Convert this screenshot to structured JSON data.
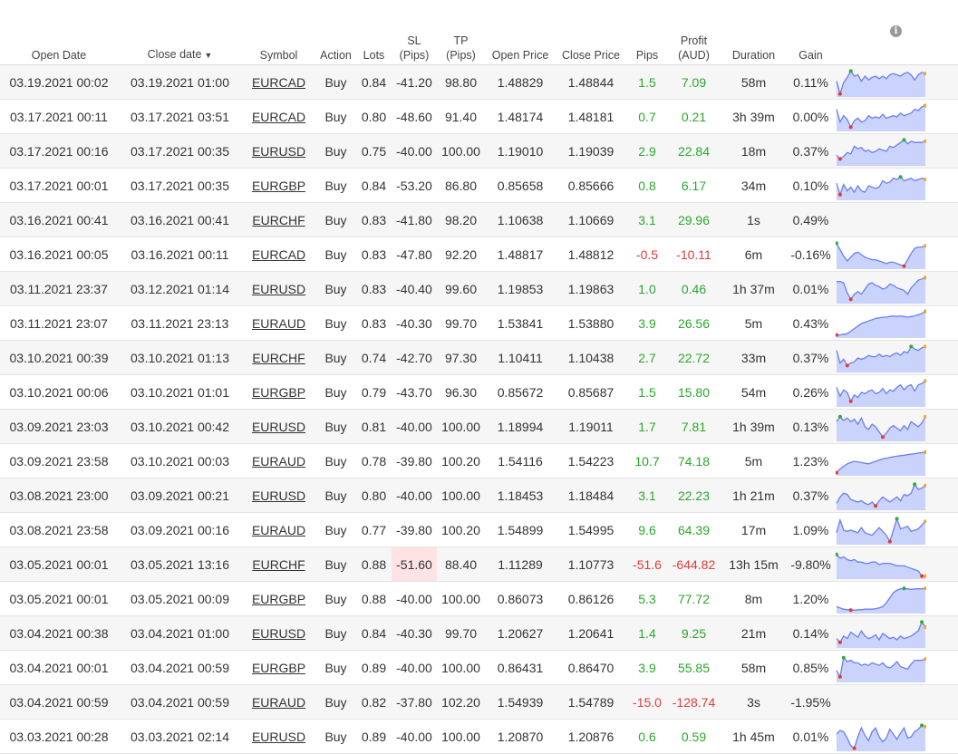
{
  "headers": {
    "open_date": "Open Date",
    "close_date": "Close date",
    "sort_caret": "▼",
    "symbol": "Symbol",
    "action": "Action",
    "lots": "Lots",
    "sl_1": "SL",
    "sl_2": "(Pips)",
    "tp_1": "TP",
    "tp_2": "(Pips)",
    "open_price": "Open Price",
    "close_price": "Close Price",
    "pips": "Pips",
    "profit_1": "Profit",
    "profit_2": "(AUD)",
    "duration": "Duration",
    "gain": "Gain",
    "info": "i"
  },
  "colors": {
    "positive": "#2aa82a",
    "negative": "#e03c3c",
    "highlight": "#fde3e3",
    "spark_line": "#6a7ff0",
    "spark_fill": "#c9d3fb",
    "spark_low": "#e53935",
    "spark_high": "#2eaa3a",
    "spark_last": "#f5a623"
  },
  "trades": [
    {
      "open": "03.19.2021 00:02",
      "close": "03.19.2021 01:00",
      "symbol": "EURCAD",
      "action": "Buy",
      "lots": "0.84",
      "sl": "-41.20",
      "tp": "98.80",
      "open_price": "1.48829",
      "close_price": "1.48844",
      "pips": "1.5",
      "profit": "7.09",
      "duration": "58m",
      "gain": "0.11%",
      "sign": "pos",
      "spark": [
        0.55,
        0.05,
        0.5,
        0.7,
        0.95,
        0.75,
        0.8,
        0.55,
        0.75,
        0.6,
        0.7,
        0.75,
        0.65,
        0.75,
        0.65,
        0.8,
        0.85,
        0.8,
        0.75,
        0.85,
        0.9,
        0.8,
        0.6,
        0.8,
        0.9,
        0.85
      ]
    },
    {
      "open": "03.17.2021 00:11",
      "close": "03.17.2021 03:51",
      "symbol": "EURCAD",
      "action": "Buy",
      "lots": "0.80",
      "sl": "-48.60",
      "tp": "91.40",
      "open_price": "1.48174",
      "close_price": "1.48181",
      "pips": "0.7",
      "profit": "0.21",
      "duration": "3h 39m",
      "gain": "0.00%",
      "sign": "pos",
      "spark": [
        0.8,
        0.3,
        0.55,
        0.4,
        0.1,
        0.35,
        0.45,
        0.3,
        0.35,
        0.55,
        0.45,
        0.5,
        0.45,
        0.6,
        0.45,
        0.5,
        0.55,
        0.5,
        0.65,
        0.55,
        0.6,
        0.65,
        0.8,
        0.75,
        0.9,
        0.95
      ]
    },
    {
      "open": "03.17.2021 00:16",
      "close": "03.17.2021 00:35",
      "symbol": "EURUSD",
      "action": "Buy",
      "lots": "0.75",
      "sl": "-40.00",
      "tp": "100.00",
      "open_price": "1.19010",
      "close_price": "1.19039",
      "pips": "2.9",
      "profit": "22.84",
      "duration": "18m",
      "gain": "0.37%",
      "sign": "pos",
      "spark": [
        0.35,
        0.2,
        0.3,
        0.45,
        0.4,
        0.7,
        0.6,
        0.65,
        0.5,
        0.55,
        0.45,
        0.5,
        0.6,
        0.55,
        0.5,
        0.7,
        0.65,
        0.75,
        0.85,
        0.95,
        0.8,
        0.9,
        0.85,
        0.85,
        0.85,
        0.9
      ]
    },
    {
      "open": "03.17.2021 00:01",
      "close": "03.17.2021 00:35",
      "symbol": "EURGBP",
      "action": "Buy",
      "lots": "0.84",
      "sl": "-53.20",
      "tp": "86.80",
      "open_price": "0.85658",
      "close_price": "0.85666",
      "pips": "0.8",
      "profit": "6.17",
      "duration": "34m",
      "gain": "0.10%",
      "sign": "pos",
      "spark": [
        0.6,
        0.15,
        0.55,
        0.3,
        0.45,
        0.25,
        0.5,
        0.3,
        0.25,
        0.5,
        0.45,
        0.4,
        0.45,
        0.7,
        0.6,
        0.65,
        0.8,
        0.75,
        0.85,
        0.7,
        0.75,
        0.8,
        0.7,
        0.75,
        0.8,
        0.75
      ]
    },
    {
      "open": "03.16.2021 00:41",
      "close": "03.16.2021 00:41",
      "symbol": "EURCHF",
      "action": "Buy",
      "lots": "0.83",
      "sl": "-41.80",
      "tp": "98.20",
      "open_price": "1.10638",
      "close_price": "1.10669",
      "pips": "3.1",
      "profit": "29.96",
      "duration": "1s",
      "gain": "0.49%",
      "sign": "pos",
      "spark": []
    },
    {
      "open": "03.16.2021 00:05",
      "close": "03.16.2021 00:11",
      "symbol": "EURCAD",
      "action": "Buy",
      "lots": "0.83",
      "sl": "-47.80",
      "tp": "92.20",
      "open_price": "1.48817",
      "close_price": "1.48812",
      "pips": "-0.5",
      "profit": "-10.11",
      "duration": "6m",
      "gain": "-0.16%",
      "sign": "neg",
      "spark": [
        0.95,
        0.7,
        0.45,
        0.25,
        0.4,
        0.55,
        0.6,
        0.5,
        0.4,
        0.35,
        0.3,
        0.3,
        0.25,
        0.2,
        0.15,
        0.2,
        0.2,
        0.15,
        0.1,
        0.05,
        0.3,
        0.55,
        0.75,
        0.8,
        0.8,
        0.85
      ]
    },
    {
      "open": "03.11.2021 23:37",
      "close": "03.12.2021 01:14",
      "symbol": "EURUSD",
      "action": "Buy",
      "lots": "0.83",
      "sl": "-40.40",
      "tp": "99.60",
      "open_price": "1.19853",
      "close_price": "1.19863",
      "pips": "1.0",
      "profit": "0.46",
      "duration": "1h 37m",
      "gain": "0.01%",
      "sign": "pos",
      "spark": [
        0.8,
        0.8,
        0.75,
        0.35,
        0.1,
        0.3,
        0.4,
        0.3,
        0.5,
        0.7,
        0.75,
        0.65,
        0.6,
        0.5,
        0.55,
        0.7,
        0.65,
        0.55,
        0.5,
        0.45,
        0.3,
        0.55,
        0.7,
        0.85,
        0.9,
        0.95
      ]
    },
    {
      "open": "03.11.2021 23:07",
      "close": "03.11.2021 23:13",
      "symbol": "EURAUD",
      "action": "Buy",
      "lots": "0.83",
      "sl": "-40.30",
      "tp": "99.70",
      "open_price": "1.53841",
      "close_price": "1.53880",
      "pips": "3.9",
      "profit": "26.56",
      "duration": "5m",
      "gain": "0.43%",
      "sign": "pos",
      "spark": [
        0.05,
        0.05,
        0.08,
        0.1,
        0.2,
        0.3,
        0.4,
        0.5,
        0.55,
        0.6,
        0.65,
        0.7,
        0.72,
        0.75,
        0.75,
        0.78,
        0.8,
        0.78,
        0.8,
        0.78,
        0.75,
        0.78,
        0.8,
        0.85,
        0.9,
        0.98
      ]
    },
    {
      "open": "03.10.2021 00:39",
      "close": "03.10.2021 01:13",
      "symbol": "EURCHF",
      "action": "Buy",
      "lots": "0.74",
      "sl": "-42.70",
      "tp": "97.30",
      "open_price": "1.10411",
      "close_price": "1.10438",
      "pips": "2.7",
      "profit": "22.72",
      "duration": "33m",
      "gain": "0.37%",
      "sign": "pos",
      "spark": [
        0.8,
        0.3,
        0.45,
        0.2,
        0.3,
        0.35,
        0.5,
        0.45,
        0.5,
        0.6,
        0.55,
        0.55,
        0.65,
        0.55,
        0.6,
        0.55,
        0.65,
        0.7,
        0.6,
        0.75,
        0.7,
        0.95,
        0.85,
        0.8,
        0.9,
        0.95
      ]
    },
    {
      "open": "03.10.2021 00:06",
      "close": "03.10.2021 01:01",
      "symbol": "EURGBP",
      "action": "Buy",
      "lots": "0.79",
      "sl": "-43.70",
      "tp": "96.30",
      "open_price": "0.85672",
      "close_price": "0.85687",
      "pips": "1.5",
      "profit": "15.80",
      "duration": "54m",
      "gain": "0.26%",
      "sign": "pos",
      "spark": [
        0.7,
        0.35,
        0.6,
        0.5,
        0.15,
        0.4,
        0.3,
        0.5,
        0.45,
        0.55,
        0.6,
        0.45,
        0.5,
        0.65,
        0.45,
        0.6,
        0.55,
        0.7,
        0.8,
        0.6,
        0.75,
        0.8,
        0.55,
        0.8,
        0.85,
        0.95
      ]
    },
    {
      "open": "03.09.2021 23:03",
      "close": "03.10.2021 00:42",
      "symbol": "EURUSD",
      "action": "Buy",
      "lots": "0.81",
      "sl": "-40.00",
      "tp": "100.00",
      "open_price": "1.18994",
      "close_price": "1.19011",
      "pips": "1.7",
      "profit": "7.81",
      "duration": "1h 39m",
      "gain": "0.13%",
      "sign": "pos",
      "spark": [
        0.7,
        0.9,
        0.75,
        0.85,
        0.7,
        0.8,
        0.6,
        0.85,
        0.5,
        0.4,
        0.6,
        0.5,
        0.3,
        0.1,
        0.25,
        0.45,
        0.55,
        0.45,
        0.35,
        0.55,
        0.4,
        0.7,
        0.6,
        0.5,
        0.65,
        0.9
      ]
    },
    {
      "open": "03.09.2021 23:58",
      "close": "03.10.2021 00:03",
      "symbol": "EURAUD",
      "action": "Buy",
      "lots": "0.78",
      "sl": "-39.80",
      "tp": "100.20",
      "open_price": "1.54116",
      "close_price": "1.54223",
      "pips": "10.7",
      "profit": "74.18",
      "duration": "5m",
      "gain": "1.23%",
      "sign": "pos",
      "spark": [
        0.05,
        0.2,
        0.3,
        0.4,
        0.45,
        0.5,
        0.48,
        0.45,
        0.42,
        0.4,
        0.45,
        0.5,
        0.55,
        0.6,
        0.62,
        0.65,
        0.68,
        0.7,
        0.72,
        0.74,
        0.76,
        0.78,
        0.8,
        0.82,
        0.84,
        0.86
      ]
    },
    {
      "open": "03.08.2021 23:00",
      "close": "03.09.2021 00:21",
      "symbol": "EURUSD",
      "action": "Buy",
      "lots": "0.80",
      "sl": "-40.00",
      "tp": "100.00",
      "open_price": "1.18453",
      "close_price": "1.18484",
      "pips": "3.1",
      "profit": "22.23",
      "duration": "1h 21m",
      "gain": "0.37%",
      "sign": "pos",
      "spark": [
        0.2,
        0.45,
        0.6,
        0.55,
        0.35,
        0.3,
        0.25,
        0.3,
        0.2,
        0.15,
        0.25,
        0.1,
        0.3,
        0.45,
        0.35,
        0.25,
        0.35,
        0.45,
        0.3,
        0.55,
        0.5,
        0.6,
        0.95,
        0.75,
        0.8,
        0.9
      ]
    },
    {
      "open": "03.08.2021 23:58",
      "close": "03.09.2021 00:16",
      "symbol": "EURAUD",
      "action": "Buy",
      "lots": "0.77",
      "sl": "-39.80",
      "tp": "100.20",
      "open_price": "1.54899",
      "close_price": "1.54995",
      "pips": "9.6",
      "profit": "64.39",
      "duration": "17m",
      "gain": "1.09%",
      "sign": "pos",
      "spark": [
        0.4,
        0.9,
        0.5,
        0.45,
        0.5,
        0.45,
        0.4,
        0.6,
        0.4,
        0.35,
        0.3,
        0.45,
        0.6,
        0.45,
        0.3,
        0.05,
        0.5,
        0.95,
        0.55,
        0.6,
        0.65,
        0.45,
        0.5,
        0.55,
        0.7,
        0.85
      ]
    },
    {
      "open": "03.05.2021 00:01",
      "close": "03.05.2021 13:16",
      "symbol": "EURCHF",
      "action": "Buy",
      "lots": "0.88",
      "sl": "-51.60",
      "tp": "88.40",
      "open_price": "1.11289",
      "close_price": "1.10773",
      "pips": "-51.6",
      "profit": "-644.82",
      "duration": "13h 15m",
      "gain": "-9.80%",
      "sign": "neg",
      "sl_highlight": true,
      "spark": [
        0.9,
        0.75,
        0.8,
        0.7,
        0.65,
        0.7,
        0.6,
        0.6,
        0.55,
        0.55,
        0.6,
        0.6,
        0.5,
        0.55,
        0.55,
        0.55,
        0.5,
        0.45,
        0.45,
        0.45,
        0.4,
        0.35,
        0.3,
        0.25,
        0.05,
        0.05
      ]
    },
    {
      "open": "03.05.2021 00:01",
      "close": "03.05.2021 00:09",
      "symbol": "EURGBP",
      "action": "Buy",
      "lots": "0.88",
      "sl": "-40.00",
      "tp": "100.00",
      "open_price": "0.86073",
      "close_price": "0.86126",
      "pips": "5.3",
      "profit": "77.72",
      "duration": "8m",
      "gain": "1.20%",
      "sign": "pos",
      "spark": [
        0.2,
        0.15,
        0.1,
        0.08,
        0.06,
        0.06,
        0.08,
        0.08,
        0.1,
        0.1,
        0.1,
        0.12,
        0.15,
        0.2,
        0.35,
        0.55,
        0.75,
        0.85,
        0.9,
        0.92,
        0.9,
        0.88,
        0.9,
        0.9,
        0.9,
        0.92
      ]
    },
    {
      "open": "03.04.2021 00:38",
      "close": "03.04.2021 01:00",
      "symbol": "EURUSD",
      "action": "Buy",
      "lots": "0.84",
      "sl": "-40.30",
      "tp": "99.70",
      "open_price": "1.20627",
      "close_price": "1.20641",
      "pips": "1.4",
      "profit": "9.25",
      "duration": "21m",
      "gain": "0.14%",
      "sign": "pos",
      "spark": [
        0.3,
        0.15,
        0.4,
        0.3,
        0.55,
        0.45,
        0.35,
        0.6,
        0.4,
        0.3,
        0.35,
        0.45,
        0.25,
        0.5,
        0.4,
        0.3,
        0.35,
        0.25,
        0.4,
        0.3,
        0.35,
        0.4,
        0.5,
        0.6,
        0.95,
        0.75
      ]
    },
    {
      "open": "03.04.2021 00:01",
      "close": "03.04.2021 00:59",
      "symbol": "EURGBP",
      "action": "Buy",
      "lots": "0.89",
      "sl": "-40.00",
      "tp": "100.00",
      "open_price": "0.86431",
      "close_price": "0.86470",
      "pips": "3.9",
      "profit": "55.85",
      "duration": "58m",
      "gain": "0.85%",
      "sign": "pos",
      "spark": [
        0.4,
        0.15,
        0.9,
        0.75,
        0.8,
        0.7,
        0.7,
        0.6,
        0.65,
        0.6,
        0.7,
        0.65,
        0.6,
        0.7,
        0.55,
        0.5,
        0.6,
        0.75,
        0.55,
        0.5,
        0.45,
        0.65,
        0.8,
        0.8,
        0.8,
        0.85
      ]
    },
    {
      "open": "03.04.2021 00:59",
      "close": "03.04.2021 00:59",
      "symbol": "EURAUD",
      "action": "Buy",
      "lots": "0.82",
      "sl": "-37.80",
      "tp": "102.20",
      "open_price": "1.54939",
      "close_price": "1.54789",
      "pips": "-15.0",
      "profit": "-128.74",
      "duration": "3s",
      "gain": "-1.95%",
      "sign": "neg",
      "spark": []
    },
    {
      "open": "03.03.2021 00:28",
      "close": "03.03.2021 02:14",
      "symbol": "EURUSD",
      "action": "Buy",
      "lots": "0.89",
      "sl": "-40.00",
      "tp": "100.00",
      "open_price": "1.20870",
      "close_price": "1.20876",
      "pips": "0.6",
      "profit": "0.59",
      "duration": "1h 45m",
      "gain": "0.01%",
      "sign": "pos",
      "spark": [
        0.6,
        0.75,
        0.7,
        0.45,
        0.15,
        0.05,
        0.5,
        0.85,
        0.55,
        0.35,
        0.7,
        0.85,
        0.5,
        0.3,
        0.45,
        0.8,
        0.6,
        0.4,
        0.65,
        0.85,
        0.45,
        0.5,
        0.7,
        0.8,
        0.95,
        0.9
      ]
    }
  ]
}
